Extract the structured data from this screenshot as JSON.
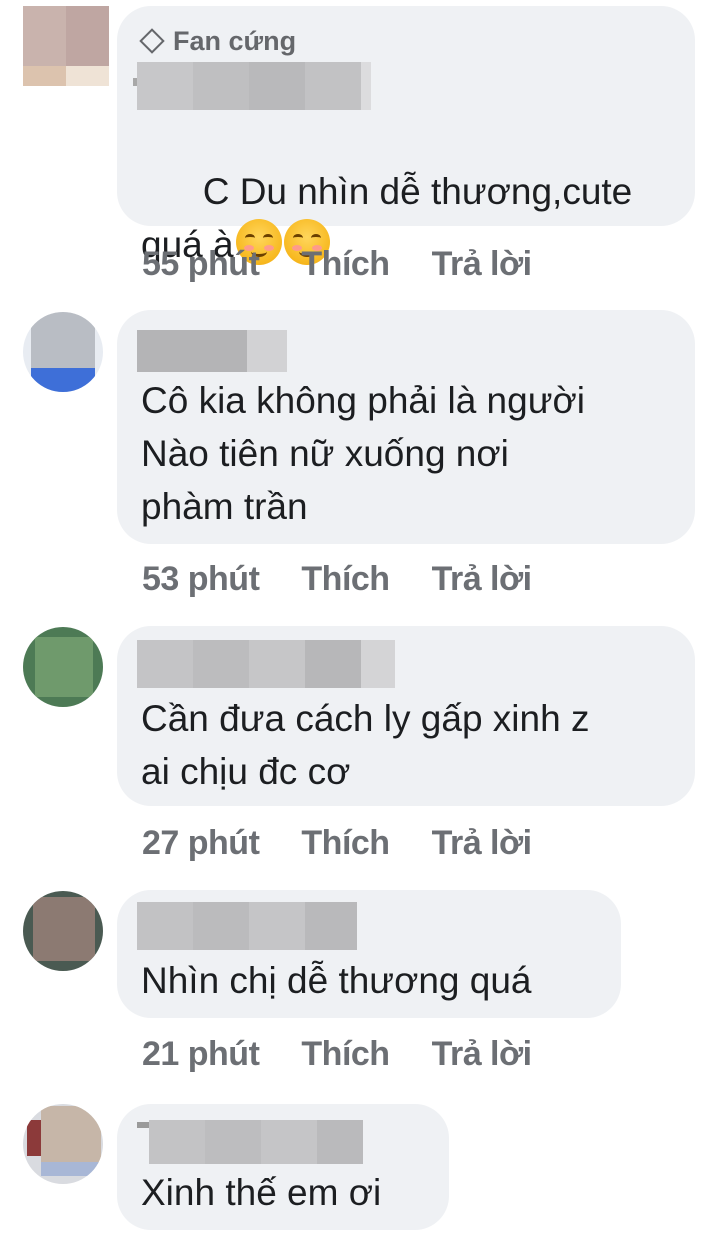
{
  "comments": [
    {
      "badge": "Fan cứng",
      "text": "C Du nhìn dễ thương,cute\nquá à",
      "emoji": [
        "smiling-face-icon",
        "smiling-face-icon"
      ],
      "time": "55 phút",
      "like_label": "Thích",
      "reply_label": "Trả lời"
    },
    {
      "text": "Cô kia không phải là người\nNào tiên nữ xuống nơi\nphàm trần",
      "time": "53 phút",
      "like_label": "Thích",
      "reply_label": "Trả lời"
    },
    {
      "text": "Cần đưa cách ly gấp xinh z\nai chịu đc cơ",
      "time": "27 phút",
      "like_label": "Thích",
      "reply_label": "Trả lời"
    },
    {
      "text": "Nhìn chị dễ thương quá",
      "time": "21 phút",
      "like_label": "Thích",
      "reply_label": "Trả lời"
    },
    {
      "text": "Xinh thế em ơi"
    }
  ],
  "colors": {
    "bubble": "#eff1f4",
    "text": "#1c1e21",
    "meta": "#6c6f74"
  }
}
